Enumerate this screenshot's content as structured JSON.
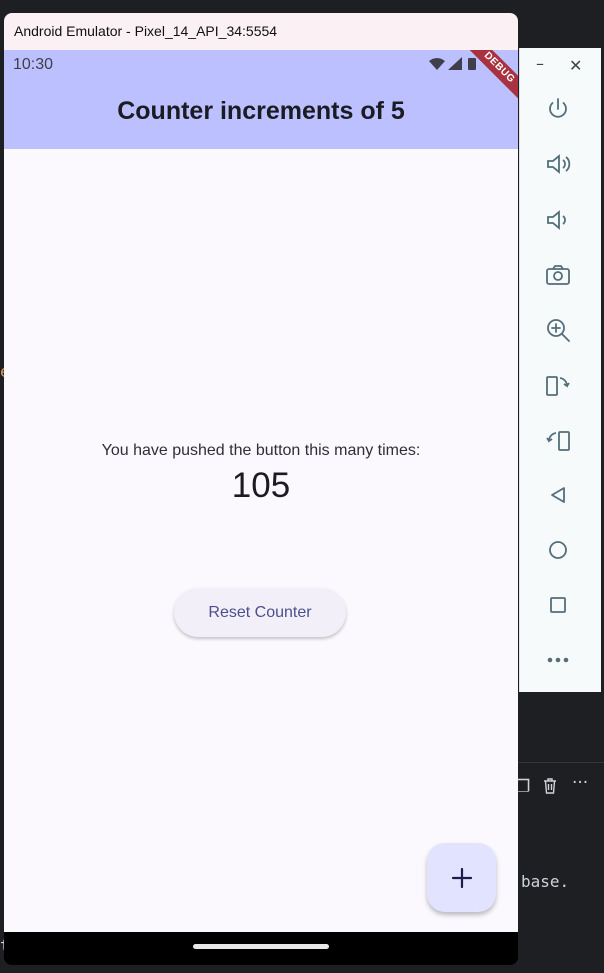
{
  "window": {
    "title": "Android Emulator - Pixel_14_API_34:5554"
  },
  "status_bar": {
    "time": "10:30"
  },
  "app_bar": {
    "title": "Counter increments of 5",
    "debug_banner": "DEBUG"
  },
  "body": {
    "pushed_label": "You have pushed the button this many times:",
    "counter_value": "105",
    "reset_button_label": "Reset Counter"
  },
  "fab": {
    "icon": "add-icon",
    "symbol": "+"
  },
  "side_panel": {
    "window_controls": [
      "minimize-icon",
      "close-icon"
    ],
    "buttons": [
      "power-icon",
      "volume-up-icon",
      "volume-down-icon",
      "camera-icon",
      "zoom-in-icon",
      "rotate-left-icon",
      "rotate-right-icon",
      "back-icon",
      "home-icon",
      "overview-icon",
      "more-icon"
    ]
  },
  "ide_background": {
    "fragment_right": "base.",
    "fragment_left_e": "e",
    "fragment_left_t": "t"
  },
  "colors": {
    "app_bar": "#bcc0ff",
    "surface": "#fbf8fe",
    "fab": "#e2e3ff",
    "debug": "#a8323f",
    "button_text": "#4b4f8e"
  }
}
